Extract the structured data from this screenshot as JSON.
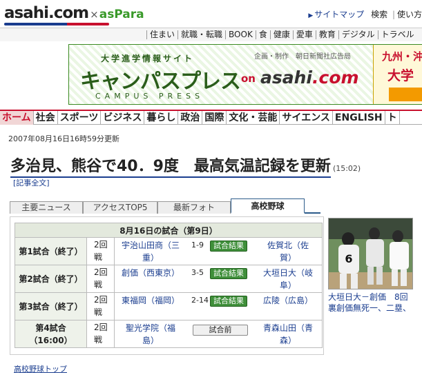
{
  "header": {
    "logo_asahi": "asahi",
    "logo_com": ".com",
    "logo_x": "×",
    "logo_aspara": "asPara",
    "links": [
      "サイトマップ",
      "検索",
      "使い方"
    ]
  },
  "sections": [
    "住まい",
    "就職・転職",
    "BOOK",
    "食",
    "健康",
    "愛車",
    "教育",
    "デジタル",
    "トラベル"
  ],
  "banner": {
    "subtitle": "大学進学情報サイト",
    "credit": "企画・制作　朝日新聞社広告局",
    "title": "キャンパスプレス",
    "on": "on",
    "asahi": "asahi",
    "dotcom": ".com",
    "romaji": "CAMPUS PRESS",
    "side1": "九州・沖",
    "side2": "大学"
  },
  "nav": [
    "ホーム",
    "社会",
    "スポーツ",
    "ビジネス",
    "暮らし",
    "政治",
    "国際",
    "文化・芸能",
    "サイエンス",
    "ENGLISH",
    "ト"
  ],
  "article": {
    "updated": "2007年08月16日16時59分更新",
    "headline": "多治見、熊谷で40．9度　最高気温記録を更新",
    "time": "(15:02)",
    "fulltext": "[記事全文]"
  },
  "tabs": [
    "主要ニュース",
    "アクセスTOP5",
    "最新フォト",
    "高校野球"
  ],
  "games": {
    "caption": "8月16日の試合（第9日）",
    "rows": [
      {
        "label": "第1試合（終了）",
        "round": "2回戦",
        "home": "宇治山田商（三重）",
        "score": "1-9",
        "button": "試合結果",
        "away": "佐賀北（佐賀）"
      },
      {
        "label": "第2試合（終了）",
        "round": "2回戦",
        "home": "創価（西東京）",
        "score": "3-5",
        "button": "試合結果",
        "away": "大垣日大（岐阜）"
      },
      {
        "label": "第3試合（終了）",
        "round": "2回戦",
        "home": "東福岡（福岡）",
        "score": "2-14",
        "button": "試合結果",
        "away": "広陵（広島）"
      },
      {
        "label": "第4試合（16:00）",
        "round": "2回戦",
        "home": "聖光学院（福島）",
        "score": "",
        "button": "試合前",
        "away": "青森山田（青森）"
      }
    ]
  },
  "link_hs_top": "高校野球トップ",
  "photo_caption": "大垣日大－創価　8回裏創価無死一、二塁、",
  "photo_number": "6"
}
